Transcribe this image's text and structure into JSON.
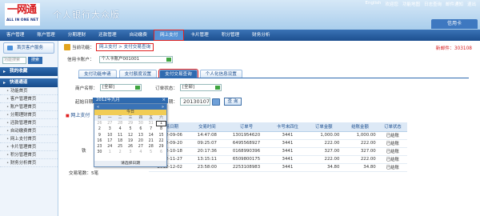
{
  "header": {
    "logo_cn": "一网通",
    "logo_en": "ALL IN ONE NET",
    "app_title": "个人银行大众版",
    "top_links": [
      "English",
      "欢迎您",
      "功能地图",
      "日志查询",
      "邮件通知",
      "退出"
    ],
    "account_tab": "信用卡"
  },
  "nav": {
    "items": [
      "客户管理",
      "账户管理",
      "分期理财",
      "还款管理",
      "自动缴费",
      "网上支付",
      "卡片管理",
      "积分管理",
      "财务分析"
    ],
    "active_index": 5
  },
  "sidebar": {
    "position_label": "首页客户服务",
    "search_placeholder": "功能搜索",
    "search_button": "搜索",
    "group1": "我的收藏",
    "group2": "快速通道",
    "items": [
      "功能首页",
      "客户管理首页",
      "账户管理首页",
      "分期理财首页",
      "还款管理首页",
      "自动缴费首页",
      "网上支付首页",
      "卡片管理首页",
      "积分管理首页",
      "财务分析首页"
    ]
  },
  "crumb": {
    "prefix": "当前功能：",
    "path": "网上支付 > 支付交易查询",
    "new_msg": "新邮件：303108"
  },
  "card": {
    "label": "信用卡账户：",
    "value": "个人卡账户001001"
  },
  "tabs": [
    "支付功能申请",
    "支付额度设置",
    "支付交易查询",
    "个人化信息设置"
  ],
  "active_tab": 2,
  "form": {
    "merchant_label": "商户名称：",
    "merchant_value": "[全部]",
    "status_label": "订单状态：",
    "status_value": "[全部]",
    "start_label": "起始日期：",
    "start_value": "20120901",
    "end_label": "终止日期：",
    "end_value": "20130107",
    "query_button": "查 询"
  },
  "section_title": "网上支付",
  "table": {
    "headers": [
      "交易日期",
      "交易时间",
      "订单号",
      "卡号末四位",
      "订单金额",
      "结账金额",
      "订单状态"
    ],
    "rows": [
      [
        "2012-09-06",
        "14:47:08",
        "1301954620",
        "3441",
        "1,000.00",
        "1,000.00",
        "已结账"
      ],
      [
        "2012-09-20",
        "09:25:07",
        "6495568927",
        "3441",
        "222.00",
        "222.00",
        "已结账"
      ],
      [
        "2012-10-18",
        "20:17:36",
        "0168990396",
        "3441",
        "327.00",
        "327.00",
        "已结账"
      ],
      [
        "2012-11-27",
        "13:15:11",
        "6509800175",
        "3441",
        "222.00",
        "222.00",
        "已结账"
      ],
      [
        "2012-12-02",
        "23:58:00",
        "2253108983",
        "3441",
        "34.80",
        "34.80",
        "已结账"
      ]
    ]
  },
  "count": "交易笔数：5笔",
  "strip_labels": [
    "",
    "",
    "铁",
    "",
    "",
    ""
  ],
  "calendar": {
    "header": "2012年九月",
    "close": "×",
    "nav_prev": "«",
    "nav_next": "»",
    "today": "今日",
    "weekdays": [
      "日",
      "一",
      "二",
      "三",
      "四",
      "五",
      "六"
    ],
    "days": [
      "26",
      "27",
      "28",
      "29",
      "30",
      "31",
      "1",
      "2",
      "3",
      "4",
      "5",
      "6",
      "7",
      "8",
      "9",
      "10",
      "11",
      "12",
      "13",
      "14",
      "15",
      "16",
      "17",
      "18",
      "19",
      "20",
      "21",
      "22",
      "23",
      "24",
      "25",
      "26",
      "27",
      "28",
      "29",
      "30",
      "1",
      "2",
      "3",
      "4",
      "5",
      "6"
    ],
    "selected": "1",
    "time_row": "时间：",
    "footer": "请选择日期"
  }
}
